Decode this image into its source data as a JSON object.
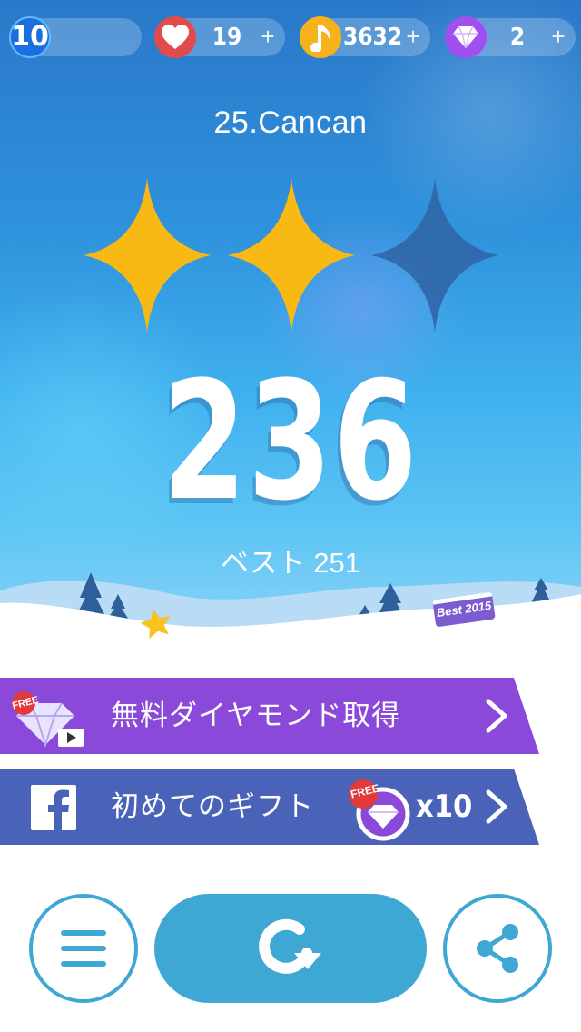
{
  "status_bar": {
    "level": "10",
    "lives": "19",
    "notes": "3632",
    "gems": "2",
    "plus": "+"
  },
  "song": {
    "title": "25.Cancan"
  },
  "result": {
    "stars_earned": 2,
    "stars_total": 3,
    "score": "236",
    "best": "ベスト 251"
  },
  "scene": {
    "sign_text": "Best 2015"
  },
  "banners": {
    "free_diamond": {
      "label": "無料ダイヤモンド取得",
      "badge": "FREE"
    },
    "first_gift": {
      "label": "初めてのギフト",
      "badge": "FREE",
      "multiplier": "x10"
    }
  },
  "colors": {
    "star_gold": "#f9b915",
    "star_empty": "#2f63a4",
    "banner_purple": "#8a49d8",
    "banner_blue": "#4a63b8",
    "button_blue": "#3ea7d3",
    "heart_red": "#e24b4b",
    "note_gold": "#f6b21a",
    "gem_purple": "#a24ff0",
    "level_blue": "#1a6fe0"
  },
  "icons": {
    "heart": "heart-icon",
    "note": "music-note-icon",
    "gem": "diamond-icon",
    "menu": "menu-icon",
    "retry": "retry-icon",
    "share": "share-icon",
    "facebook": "facebook-icon",
    "chevron": "chevron-right-icon"
  }
}
